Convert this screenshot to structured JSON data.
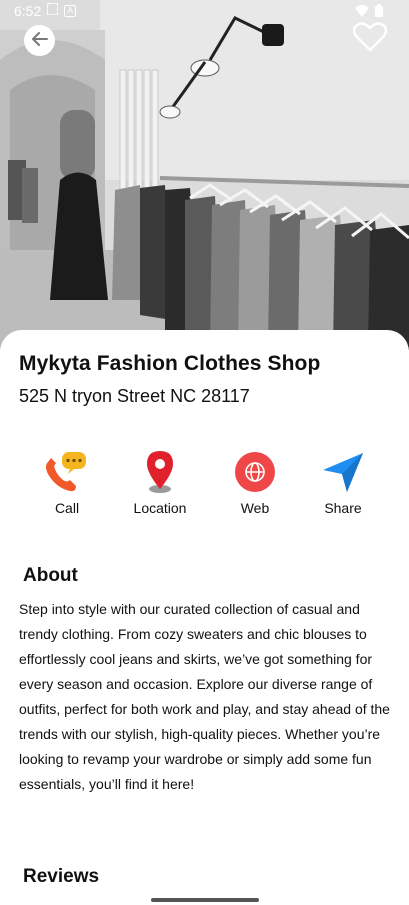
{
  "status_bar": {
    "time": "6:52",
    "a_badge": "A"
  },
  "shop": {
    "name": "Mykyta Fashion Clothes Shop",
    "address": "525 N tryon Street NC 28117"
  },
  "actions": [
    {
      "label": "Call",
      "icon": "call-chat-icon"
    },
    {
      "label": "Location",
      "icon": "map-pin-icon"
    },
    {
      "label": "Web",
      "icon": "globe-icon"
    },
    {
      "label": "Share",
      "icon": "send-icon"
    }
  ],
  "about": {
    "heading": "About",
    "text": "Step into style with our curated collection of casual and trendy clothing. From cozy sweaters and chic blouses to effortlessly cool jeans and skirts, we’ve got something for every season and occasion. Explore our diverse range of outfits, perfect for both work and play, and stay ahead of the trends with our stylish, high-quality pieces. Whether you’re looking to revamp your wardrobe or simply add some fun essentials, you’ll find it here!"
  },
  "reviews": {
    "heading": "Reviews"
  },
  "colors": {
    "call_orange": "#f0592a",
    "chat_yellow": "#f5b51e",
    "pin_red": "#e0202a",
    "globe_red": "#ef4747",
    "share_blue": "#1e8ff0"
  }
}
